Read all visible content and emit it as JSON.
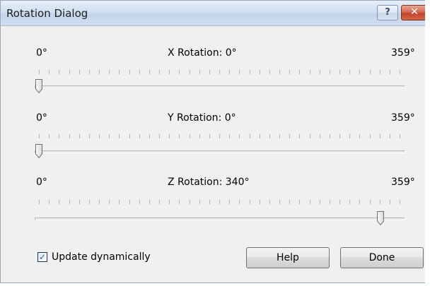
{
  "window": {
    "title": "Rotation Dialog",
    "help_caption_glyph": "?",
    "close_caption_glyph": "✕",
    "close_color": "#c9462c"
  },
  "sliders": [
    {
      "axis": "X",
      "min_label": "0°",
      "max_label": "359°",
      "title": "X Rotation: 0°",
      "min": 0,
      "max": 359,
      "value": 0
    },
    {
      "axis": "Y",
      "min_label": "0°",
      "max_label": "359°",
      "title": "Y Rotation: 0°",
      "min": 0,
      "max": 359,
      "value": 0
    },
    {
      "axis": "Z",
      "min_label": "0°",
      "max_label": "359°",
      "title": "Z Rotation: 340°",
      "min": 0,
      "max": 359,
      "value": 340
    }
  ],
  "options": {
    "update_dynamically_label": "Update dynamically",
    "update_dynamically_checked": true
  },
  "buttons": {
    "help_label": "Help",
    "done_label": "Done"
  }
}
